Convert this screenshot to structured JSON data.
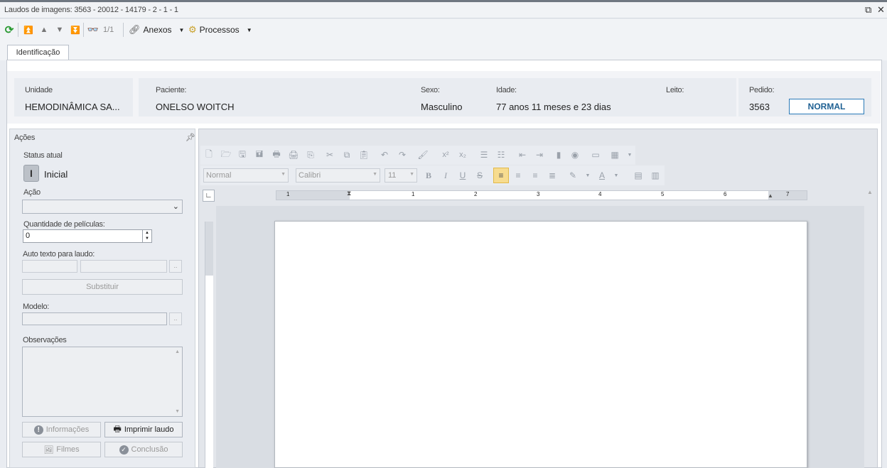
{
  "window": {
    "title": "Laudos de imagens: 3563 - 20012 - 14179 - 2 - 1 - 1"
  },
  "toolbar": {
    "page_counter": "1/1",
    "anexos_label": "Anexos",
    "processos_label": "Processos"
  },
  "tabs": [
    {
      "label": "Identificação"
    }
  ],
  "header": {
    "unidade_label": "Unidade",
    "unidade_value": "HEMODINÂMICA SA...",
    "paciente_label": "Paciente:",
    "paciente_value": "ONELSO WOITCH",
    "sexo_label": "Sexo:",
    "sexo_value": "Masculino",
    "idade_label": "Idade:",
    "idade_value": "77 anos 11 meses  e 23 dias",
    "leito_label": "Leito:",
    "leito_value": "",
    "pedido_label": "Pedido:",
    "pedido_value": "3563",
    "priority_badge": "NORMAL"
  },
  "actions": {
    "title": "Ações",
    "status_label": "Status atual",
    "status_letter": "I",
    "status_value": "Inicial",
    "acao_label": "Ação",
    "acao_value": "",
    "peliculas_label": "Quantidade de películas:",
    "peliculas_value": "0",
    "autotexto_label": "Auto texto para laudo:",
    "substituir_label": "Substituir",
    "modelo_label": "Modelo:",
    "observacoes_label": "Observações",
    "informacoes_label": "Informações",
    "imprimir_label": "Imprimir laudo",
    "filmes_label": "Filmes",
    "conclusao_label": "Conclusão",
    "ellipsis": ".."
  },
  "editor": {
    "style_value": "Normal",
    "font_value": "Calibri",
    "size_value": "11",
    "ruler_marks": [
      "1",
      "1",
      "2",
      "3",
      "4",
      "5",
      "6",
      "7"
    ]
  },
  "colors": {
    "accent": "#2b7ab8",
    "badge_text": "#1d5f92"
  }
}
